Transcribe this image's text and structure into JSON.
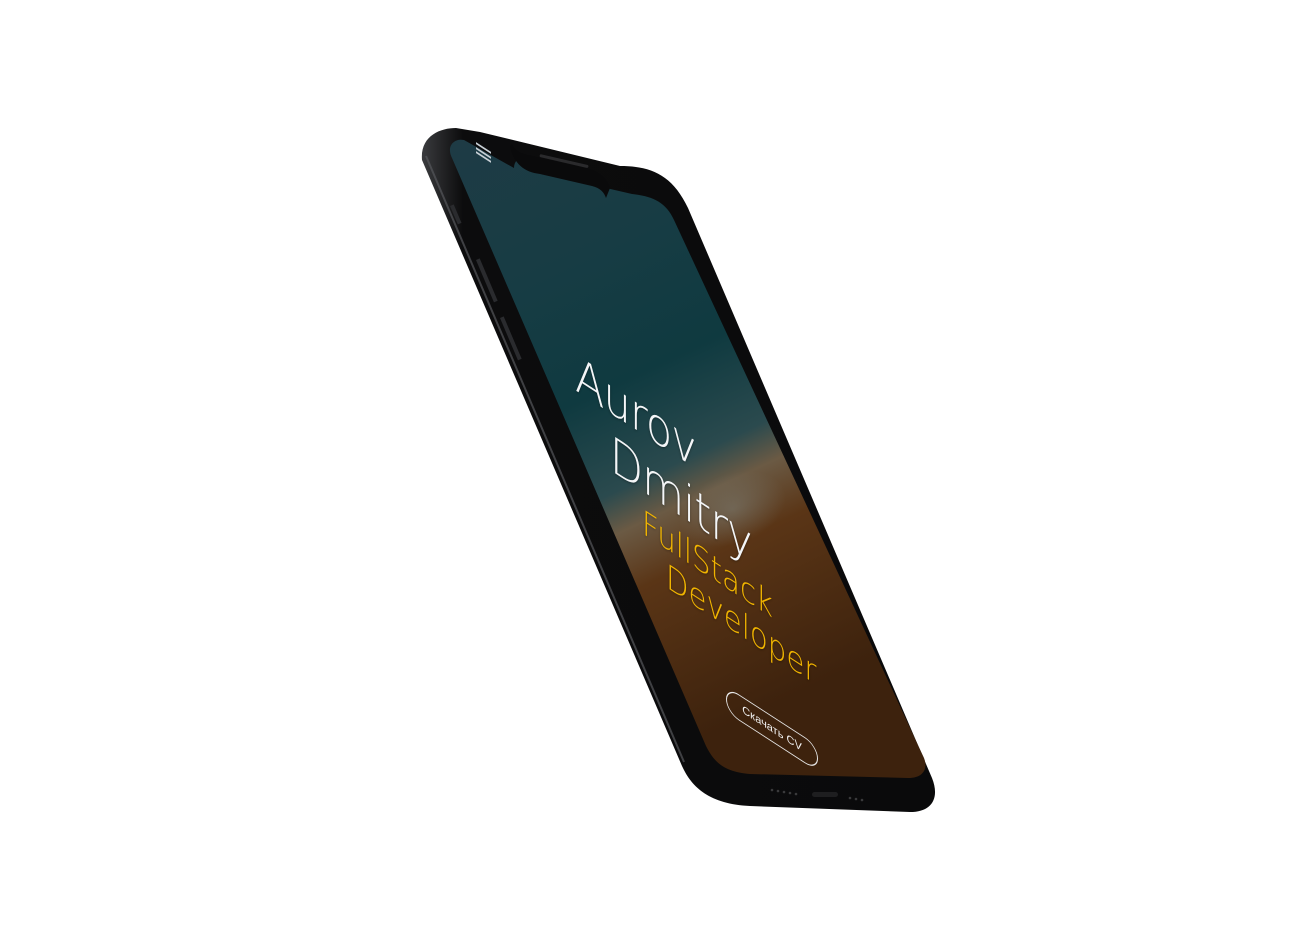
{
  "screen": {
    "menu_icon": "hamburger-menu-icon",
    "name_line_1": "Aurov",
    "name_line_2": "Dmitry",
    "role_line_1": "FullStack",
    "role_line_2": "Developer",
    "cv_button_label": "Скачать CV"
  },
  "colors": {
    "background": "#ffffff",
    "phone_body": "#111214",
    "screen_top": "#1a3a44",
    "screen_bottom": "#4a2a12",
    "name_text": "#f4f6f8",
    "role_text": "#f0b400",
    "button_border": "#e6e6e6"
  }
}
